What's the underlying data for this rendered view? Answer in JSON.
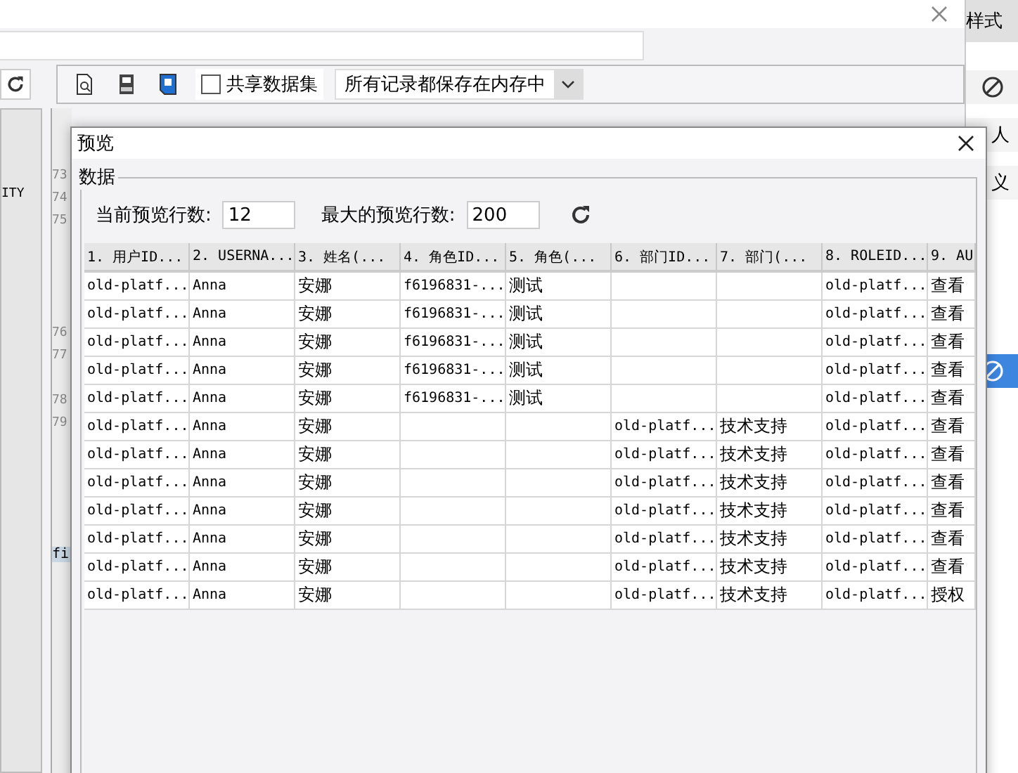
{
  "main_window": {
    "toolbar": {
      "share_checkbox": {
        "label": "共享数据集",
        "checked": false
      },
      "storage_select": {
        "value": "所有记录都保存在内存中"
      }
    },
    "side_text": "ITY",
    "line_numbers": [
      "73",
      "74",
      "75",
      "76",
      "77",
      "78",
      "79"
    ],
    "editor_fragment": "fi"
  },
  "side_panel": {
    "items": [
      {
        "kind": "text",
        "text": "样式"
      },
      {
        "kind": "icon"
      },
      {
        "kind": "text",
        "text": "人"
      },
      {
        "kind": "text",
        "text": "义"
      },
      {
        "kind": "icon",
        "selected": true
      }
    ]
  },
  "dialog": {
    "title": "预览",
    "group_label": "数据",
    "current_rows": {
      "label": "当前预览行数:",
      "value": "12"
    },
    "max_rows": {
      "label": "最大的预览行数:",
      "value": "200"
    },
    "table": {
      "columns": [
        "1. 用户ID...",
        "2. USERNA...",
        "3. 姓名(...",
        "4. 角色ID...",
        "5. 角色(...",
        "6. 部门ID...",
        "7. 部门(...",
        "8. ROLEID...",
        "9. AU"
      ],
      "rows": [
        [
          "old-platf...",
          "Anna",
          "安娜",
          "f6196831-...",
          "测试",
          null,
          null,
          "old-platf...",
          "查看"
        ],
        [
          "old-platf...",
          "Anna",
          "安娜",
          "f6196831-...",
          "测试",
          null,
          null,
          "old-platf...",
          "查看"
        ],
        [
          "old-platf...",
          "Anna",
          "安娜",
          "f6196831-...",
          "测试",
          null,
          null,
          "old-platf...",
          "查看"
        ],
        [
          "old-platf...",
          "Anna",
          "安娜",
          "f6196831-...",
          "测试",
          null,
          null,
          "old-platf...",
          "查看"
        ],
        [
          "old-platf...",
          "Anna",
          "安娜",
          "f6196831-...",
          "测试",
          null,
          null,
          "old-platf...",
          "查看"
        ],
        [
          "old-platf...",
          "Anna",
          "安娜",
          null,
          null,
          "old-platf...",
          "技术支持",
          "old-platf...",
          "查看"
        ],
        [
          "old-platf...",
          "Anna",
          "安娜",
          null,
          null,
          "old-platf...",
          "技术支持",
          "old-platf...",
          "查看"
        ],
        [
          "old-platf...",
          "Anna",
          "安娜",
          null,
          null,
          "old-platf...",
          "技术支持",
          "old-platf...",
          "查看"
        ],
        [
          "old-platf...",
          "Anna",
          "安娜",
          null,
          null,
          "old-platf...",
          "技术支持",
          "old-platf...",
          "查看"
        ],
        [
          "old-platf...",
          "Anna",
          "安娜",
          null,
          null,
          "old-platf...",
          "技术支持",
          "old-platf...",
          "查看"
        ],
        [
          "old-platf...",
          "Anna",
          "安娜",
          null,
          null,
          "old-platf...",
          "技术支持",
          "old-platf...",
          "查看"
        ],
        [
          "old-platf...",
          "Anna",
          "安娜",
          null,
          null,
          "old-platf...",
          "技术支持",
          "old-platf...",
          "授权"
        ]
      ]
    }
  }
}
